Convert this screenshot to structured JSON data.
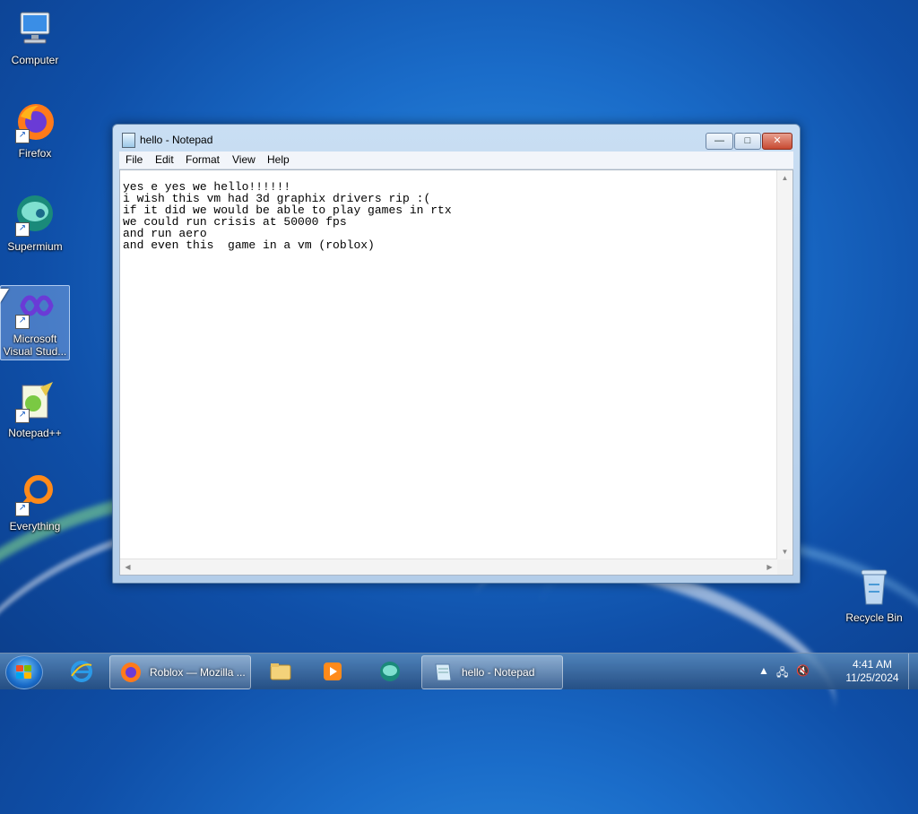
{
  "desktop": {
    "icons": [
      {
        "label": "Computer",
        "icon": "computer-icon"
      },
      {
        "label": "Firefox",
        "icon": "firefox-icon"
      },
      {
        "label": "Supermium",
        "icon": "supermium-icon"
      },
      {
        "label": "Microsoft\nVisual Stud...",
        "icon": "visual-studio-icon"
      },
      {
        "label": "Notepad++",
        "icon": "notepad-plus-plus-icon"
      },
      {
        "label": "Everything",
        "icon": "everything-icon"
      },
      {
        "label": "Recycle Bin",
        "icon": "recycle-bin-icon"
      }
    ]
  },
  "window": {
    "title": "hello - Notepad",
    "menu": [
      "File",
      "Edit",
      "Format",
      "View",
      "Help"
    ],
    "content": "yes e yes we hello!!!!!!\ni wish this vm had 3d graphix drivers rip :(\nif it did we would be able to play games in rtx\nwe could run crisis at 50000 fps\nand run aero\nand even this  game in a vm (roblox)",
    "buttons": {
      "minimize": "—",
      "maximize": "□",
      "close": "✕"
    }
  },
  "taskbar": {
    "items": [
      {
        "label": "Roblox — Mozilla ...",
        "icon": "firefox-icon",
        "active": true
      },
      {
        "label": "",
        "icon": "file-explorer-icon",
        "active": false
      },
      {
        "label": "",
        "icon": "media-player-icon",
        "active": false
      },
      {
        "label": "",
        "icon": "supermium-icon",
        "active": false
      },
      {
        "label": "hello - Notepad",
        "icon": "notepad-icon",
        "active": true
      }
    ],
    "pinned": [
      {
        "icon": "internet-explorer-icon"
      }
    ],
    "tray": {
      "time": "4:41 AM",
      "date": "11/25/2024"
    }
  },
  "colors": {
    "accent": "#1a6cc9",
    "close_red": "#c84a32"
  }
}
